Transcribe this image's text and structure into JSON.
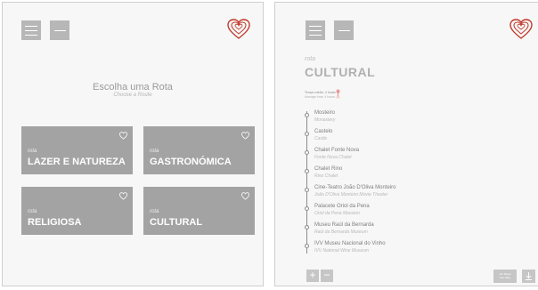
{
  "screen1": {
    "heading": "Escolha uma Rota",
    "heading_en": "Choose a Route",
    "tiles": [
      {
        "prefix": "rota",
        "name": "LAZER E NATUREZA"
      },
      {
        "prefix": "rota",
        "name": "GASTRONÓMICA"
      },
      {
        "prefix": "rota",
        "name": "RELIGIOSA"
      },
      {
        "prefix": "rota",
        "name": "CULTURAL"
      }
    ]
  },
  "screen2": {
    "prefix": "rota",
    "title": "CULTURAL",
    "time_label": "Tempo médio: 4 horas",
    "time_label_en": "Average time: 4 hours",
    "stops": [
      {
        "name": "Mosteiro",
        "en": "Monastery"
      },
      {
        "name": "Castelo",
        "en": "Castle"
      },
      {
        "name": "Chalet Fonte Nova",
        "en": "Fonte Nova Chalet"
      },
      {
        "name": "Chalet Rino",
        "en": "Rino Chalet"
      },
      {
        "name": "Cine-Teatro João D'Oliva Monteiro",
        "en": "João D'Oliva Monteiro Movie Theater"
      },
      {
        "name": "Palacete Oriol da Pena",
        "en": "Oriol da Pena Mansion"
      },
      {
        "name": "Museu Raúl da Bernarda",
        "en": "Raúl da Bernarda Museum"
      },
      {
        "name": "IVV Museu Nacional do Vinho",
        "en": "IVV National Wine Museum"
      }
    ],
    "zoom_in": "+",
    "zoom_out": "−",
    "map_button": "Ver Mapa\nSee Map"
  },
  "colors": {
    "brand": "#c0392b",
    "tile": "#a3a3a3",
    "button": "#b7b7b7"
  },
  "icons": [
    "menu-icon",
    "back-arrow-icon",
    "heart-logo-icon",
    "heart-small-icon",
    "location-pin-icon",
    "download-icon"
  ]
}
